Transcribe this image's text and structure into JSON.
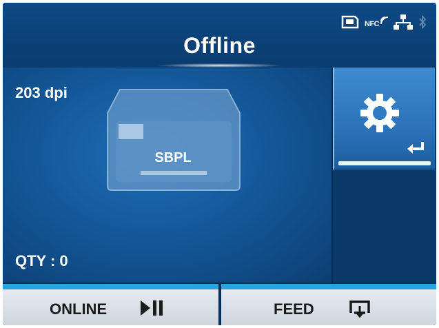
{
  "header": {
    "title": "Offline",
    "status_icons": [
      "sd-card-icon",
      "nfc-icon",
      "network-icon",
      "bluetooth-icon"
    ],
    "nfc_text": "NFC"
  },
  "main": {
    "resolution": "203 dpi",
    "command_language": "SBPL",
    "quantity": "QTY : 0"
  },
  "settings": {
    "icons": [
      "gear-icon",
      "enter-icon"
    ]
  },
  "buttons": {
    "online_label": "ONLINE",
    "feed_label": "FEED"
  },
  "colors": {
    "background": "#062d55",
    "panel": "#14589a",
    "accent": "#2aa3e4",
    "button": "#e9eef3"
  }
}
